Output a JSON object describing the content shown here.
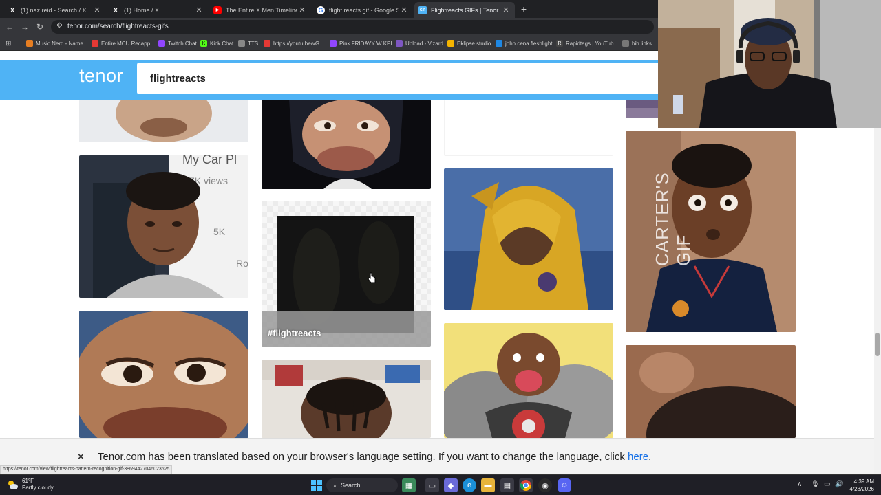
{
  "tabs": [
    {
      "title": "(1) naz reid - Search / X",
      "favicon": "x-icon",
      "close": "✕"
    },
    {
      "title": "(1) Home / X",
      "favicon": "x-icon",
      "close": "✕"
    },
    {
      "title": "The Entire X Men Timeline Expl",
      "favicon": "youtube-icon",
      "close": "✕"
    },
    {
      "title": "flight reacts gif - Google Search",
      "favicon": "google-icon",
      "close": "✕"
    },
    {
      "title": "Flightreacts GIFs | Tenor",
      "favicon": "tenor-icon",
      "close": "✕"
    }
  ],
  "new_tab": "+",
  "address": {
    "url": "tenor.com/search/flightreacts-gifs"
  },
  "bookmarks": [
    {
      "label": "Music Nerd - Name...",
      "color": "#e67e22"
    },
    {
      "label": "Entire MCU Recapp...",
      "color": "#e53935"
    },
    {
      "label": "Twitch Chat",
      "color": "#9146ff"
    },
    {
      "label": "Kick Chat",
      "color": "#53fc18"
    },
    {
      "label": "TTS",
      "color": "#888888"
    },
    {
      "label": "https://youtu.be/vG...",
      "color": "#e53935"
    },
    {
      "label": "Pink FRIDAYY W KPI...",
      "color": "#9146ff"
    },
    {
      "label": "Upload - Vizard",
      "color": "#7e57c2"
    },
    {
      "label": "Eklipse studio",
      "color": "#f4b400"
    },
    {
      "label": "john cena fleshlight",
      "color": "#1e88e5"
    },
    {
      "label": "Rapidtags | YouTub...",
      "color": "#dddddd"
    },
    {
      "label": "bih links",
      "color": "#aaaaaa"
    }
  ],
  "tenor": {
    "logo": "tenor",
    "search_value": "flightreacts",
    "tag_label": "#flightreacts",
    "watermark": "CARTER'S GIF"
  },
  "notice": {
    "close": "×",
    "text": "Tenor.com has been translated based on your browser's language setting. If you want to change the language, click ",
    "link": "here",
    "end": "."
  },
  "status_url": "https://tenor.com/view/flightreacts-pattern-recognition-gif-3869442704602362​5",
  "taskbar": {
    "temp": "61°F",
    "condition": "Partly cloudy",
    "search_label": "Search",
    "time": "4:39 AM",
    "date": "4/28/2026"
  },
  "colors": {
    "tenor_blue": "#4fb3f5",
    "link_blue": "#1a73e8"
  }
}
